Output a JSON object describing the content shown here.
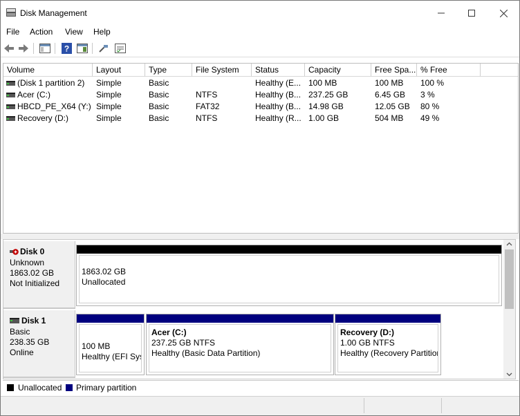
{
  "window": {
    "title": "Disk Management"
  },
  "menu": [
    "File",
    "Action",
    "View",
    "Help"
  ],
  "toolbar_icons": [
    "back-icon",
    "forward-icon",
    "show-hide-console-tree-icon",
    "help-icon",
    "properties-icon",
    "connect-icon",
    "console-list-icon"
  ],
  "columns": [
    "Volume",
    "Layout",
    "Type",
    "File System",
    "Status",
    "Capacity",
    "Free Spa...",
    "% Free"
  ],
  "volumes": [
    [
      "(Disk 1 partition 2)",
      "Simple",
      "Basic",
      "",
      "Healthy (E...",
      "100 MB",
      "100 MB",
      "100 %"
    ],
    [
      "Acer (C:)",
      "Simple",
      "Basic",
      "NTFS",
      "Healthy (B...",
      "237.25 GB",
      "6.45 GB",
      "3 %"
    ],
    [
      "HBCD_PE_X64 (Y:)",
      "Simple",
      "Basic",
      "FAT32",
      "Healthy (B...",
      "14.98 GB",
      "12.05 GB",
      "80 %"
    ],
    [
      "Recovery (D:)",
      "Simple",
      "Basic",
      "NTFS",
      "Healthy (R...",
      "1.00 GB",
      "504 MB",
      "49 %"
    ]
  ],
  "disks": [
    {
      "name": "Disk 0",
      "type": "Unknown",
      "size": "1863.02 GB",
      "state": "Not Initialized",
      "partitions": [
        {
          "line1": "",
          "line2": "1863.02 GB",
          "line3": "Unallocated"
        }
      ]
    },
    {
      "name": "Disk 1",
      "type": "Basic",
      "size": "238.35 GB",
      "state": "Online",
      "partitions": [
        {
          "line1": "",
          "line2": "100 MB",
          "line3": "Healthy (EFI Syst"
        },
        {
          "line1": "Acer  (C:)",
          "line2": "237.25 GB NTFS",
          "line3": "Healthy (Basic Data Partition)"
        },
        {
          "line1": "Recovery  (D:)",
          "line2": "1.00 GB NTFS",
          "line3": "Healthy (Recovery Partition"
        }
      ]
    }
  ],
  "legend": [
    "Unallocated",
    "Primary partition"
  ],
  "colors": {
    "unallocated": "#000000",
    "primary": "#00007f",
    "unknown_disk_badge": "#c00000"
  }
}
